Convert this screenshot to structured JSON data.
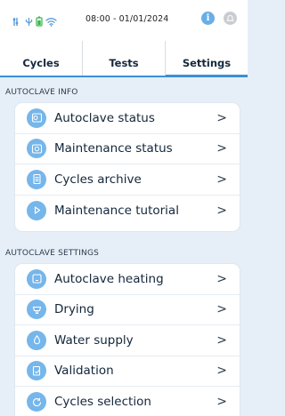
{
  "status_bar": {
    "datetime": "08:00 - 01/01/2024",
    "indicators": [
      "tools-icon",
      "usb-icon",
      "battery-icon",
      "wifi-icon"
    ],
    "info_label": "i"
  },
  "tabs": [
    {
      "label": "Cycles",
      "active": false
    },
    {
      "label": "Tests",
      "active": false
    },
    {
      "label": "Settings",
      "active": true
    }
  ],
  "autoclave_info": {
    "title": "AUTOCLAVE INFO",
    "items": [
      {
        "label": "Autoclave status",
        "icon": "autoclave-status-icon"
      },
      {
        "label": "Maintenance status",
        "icon": "maintenance-status-icon"
      },
      {
        "label": "Cycles archive",
        "icon": "cycles-archive-icon"
      },
      {
        "label": "Maintenance tutorial",
        "icon": "play-icon"
      }
    ]
  },
  "autoclave_settings": {
    "title": "AUTOCLAVE SETTINGS",
    "items": [
      {
        "label": "Autoclave heating",
        "icon": "autoclave-heating-icon"
      },
      {
        "label": "Drying",
        "icon": "drying-icon"
      },
      {
        "label": "Water supply",
        "icon": "water-drop-icon"
      },
      {
        "label": "Validation",
        "icon": "validation-icon"
      },
      {
        "label": "Cycles selection",
        "icon": "cycles-selection-icon"
      }
    ]
  },
  "chevron": ">",
  "colors": {
    "accent": "#3a8fd9",
    "icon_bg": "#76b6ea",
    "background": "#e6eef7"
  }
}
